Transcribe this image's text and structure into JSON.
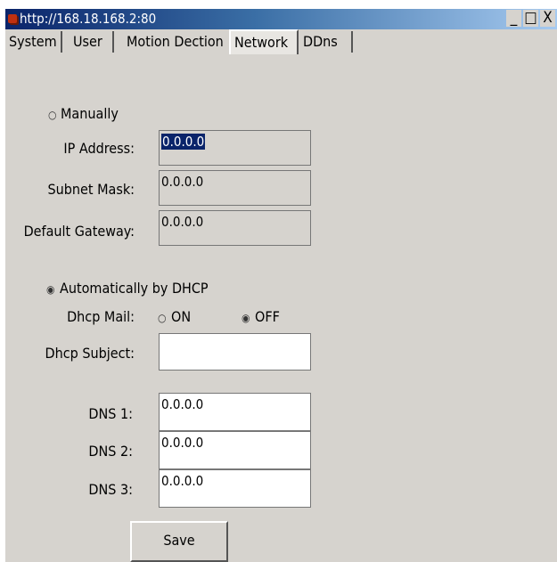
{
  "window": {
    "url": "http://168.18.168.2:80",
    "minimize_glyph": "_",
    "maximize_glyph": "□",
    "close_glyph": "X"
  },
  "tabs": [
    {
      "label": "System",
      "active": false
    },
    {
      "label": "User",
      "active": false
    },
    {
      "label": "Motion Dection",
      "active": false
    },
    {
      "label": "Network",
      "active": true
    },
    {
      "label": "DDns",
      "active": false
    }
  ],
  "manual": {
    "label": "Manually",
    "selected": false,
    "ip_label": "IP Address:",
    "ip_value": "0.0.0.0",
    "subnet_label": "Subnet Mask:",
    "subnet_value": "0.0.0.0",
    "gateway_label": "Default Gateway:",
    "gateway_value": "0.0.0.0"
  },
  "dhcp": {
    "label": "Automatically by DHCP",
    "selected": true,
    "mail_label": "Dhcp Mail:",
    "mail_on_label": "ON",
    "mail_off_label": "OFF",
    "mail_selected": "OFF",
    "subject_label": "Dhcp Subject:",
    "subject_value": ""
  },
  "dns": [
    {
      "label": "DNS 1:",
      "value": "0.0.0.0"
    },
    {
      "label": "DNS 2:",
      "value": "0.0.0.0"
    },
    {
      "label": "DNS 3:",
      "value": "0.0.0.0"
    }
  ],
  "save_label": "Save",
  "colors": {
    "titlebar_start": "#0a246a",
    "panel": "#d6d3ce",
    "selection": "#0a246a"
  },
  "radio_glyphs": {
    "unchecked": "○",
    "checked": "◉"
  }
}
